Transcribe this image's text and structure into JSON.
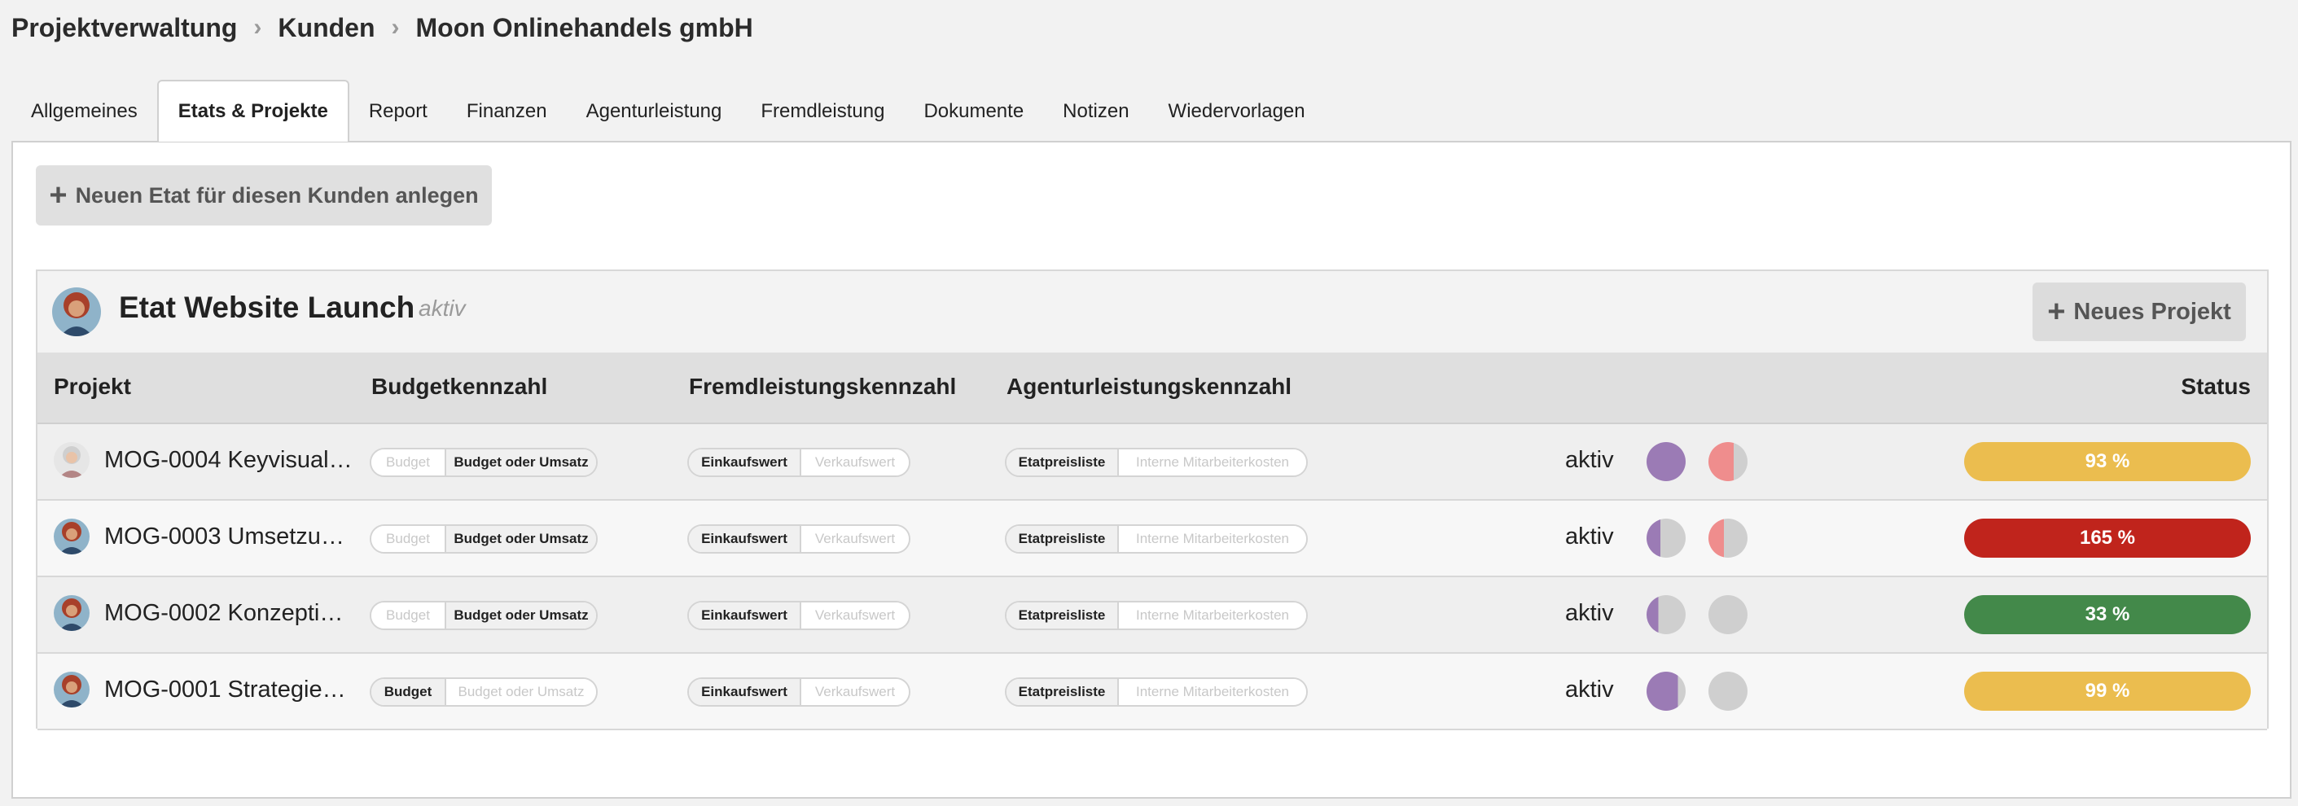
{
  "breadcrumb": [
    "Projektverwaltung",
    "Kunden",
    "Moon Onlinehandels gmbH"
  ],
  "tabs": [
    {
      "label": "Allgemeines",
      "active": false
    },
    {
      "label": "Etats & Projekte",
      "active": true
    },
    {
      "label": "Report",
      "active": false
    },
    {
      "label": "Finanzen",
      "active": false
    },
    {
      "label": "Agenturleistung",
      "active": false
    },
    {
      "label": "Fremdleistung",
      "active": false
    },
    {
      "label": "Dokumente",
      "active": false
    },
    {
      "label": "Notizen",
      "active": false
    },
    {
      "label": "Wiedervorlagen",
      "active": false
    }
  ],
  "new_etat_button": {
    "icon": "plus-icon",
    "label": "Neuen Etat für diesen Kunden anlegen"
  },
  "etat": {
    "title": "Etat Website Launch",
    "status": "aktiv",
    "new_project_button": {
      "icon": "plus-icon",
      "label": "Neues Projekt"
    }
  },
  "table": {
    "columns": {
      "project": "Projekt",
      "budget": "Budgetkennzahl",
      "fremd": "Fremdleistungskennzahl",
      "agentur": "Agenturleistungskennzahl",
      "status": "Status"
    },
    "rows": [
      {
        "name": "MOG-0004 Keyvisual…",
        "avatar": "person-grey-hair",
        "budget_options": [
          "Budget",
          "Budget oder Umsatz"
        ],
        "budget_selected": "Budget oder Umsatz",
        "fremd_options": [
          "Einkaufswert",
          "Verkaufswert"
        ],
        "fremd_selected": "Einkaufswert",
        "agentur_options": [
          "Etatpreisliste",
          "Interne Mitarbeiterkosten"
        ],
        "agentur_selected": "Etatpreisliste",
        "status": "aktiv",
        "indicator1": {
          "color": "#9b7bb5",
          "fill": 1.0
        },
        "indicator2": {
          "color": "#ef8d8d",
          "fill": 0.65
        },
        "progress": "93 %",
        "progress_color": "#ebbd4f"
      },
      {
        "name": "MOG-0003 Umsetzu…",
        "avatar": "person-red-hair",
        "budget_options": [
          "Budget",
          "Budget oder Umsatz"
        ],
        "budget_selected": "Budget oder Umsatz",
        "fremd_options": [
          "Einkaufswert",
          "Verkaufswert"
        ],
        "fremd_selected": "Einkaufswert",
        "agentur_options": [
          "Etatpreisliste",
          "Interne Mitarbeiterkosten"
        ],
        "agentur_selected": "Etatpreisliste",
        "status": "aktiv",
        "indicator1": {
          "color": "#9b7bb5",
          "fill": 0.35
        },
        "indicator2": {
          "color": "#ef8d8d",
          "fill": 0.4
        },
        "progress": "165 %",
        "progress_color": "#c0241c"
      },
      {
        "name": "MOG-0002 Konzepti…",
        "avatar": "person-red-hair",
        "budget_options": [
          "Budget",
          "Budget oder Umsatz"
        ],
        "budget_selected": "Budget oder Umsatz",
        "fremd_options": [
          "Einkaufswert",
          "Verkaufswert"
        ],
        "fremd_selected": "Einkaufswert",
        "agentur_options": [
          "Etatpreisliste",
          "Interne Mitarbeiterkosten"
        ],
        "agentur_selected": "Etatpreisliste",
        "status": "aktiv",
        "indicator1": {
          "color": "#9b7bb5",
          "fill": 0.3
        },
        "indicator2": {
          "color": "#ef8d8d",
          "fill": 0
        },
        "progress": "33 %",
        "progress_color": "#43894a"
      },
      {
        "name": "MOG-0001 Strategie…",
        "avatar": "person-red-hair",
        "budget_options": [
          "Budget",
          "Budget oder Umsatz"
        ],
        "budget_selected": "Budget",
        "fremd_options": [
          "Einkaufswert",
          "Verkaufswert"
        ],
        "fremd_selected": "Einkaufswert",
        "agentur_options": [
          "Etatpreisliste",
          "Interne Mitarbeiterkosten"
        ],
        "agentur_selected": "Etatpreisliste",
        "status": "aktiv",
        "indicator1": {
          "color": "#9b7bb5",
          "fill": 0.8
        },
        "indicator2": {
          "color": "#ef8d8d",
          "fill": 0
        },
        "progress": "99 %",
        "progress_color": "#ebbd4f"
      }
    ]
  }
}
